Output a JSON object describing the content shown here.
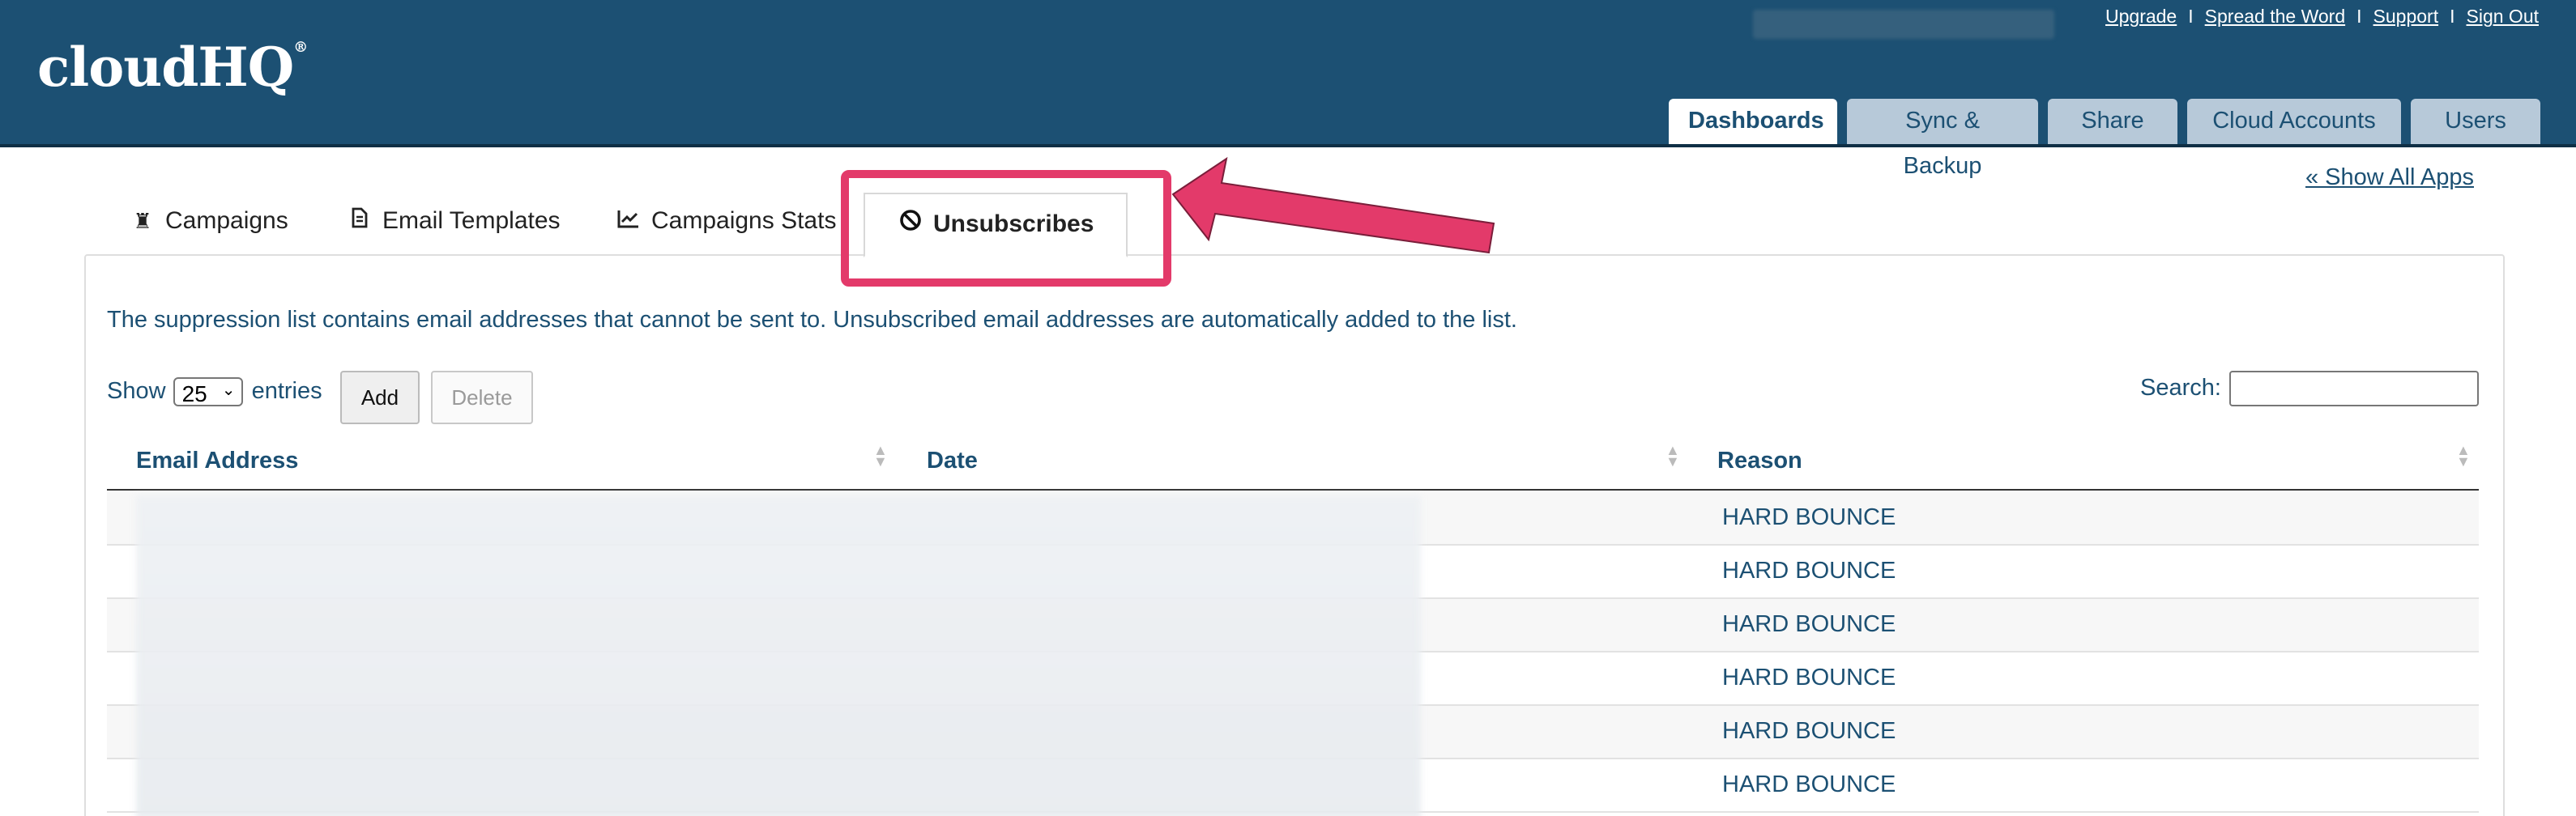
{
  "brand": {
    "logo_text": "cloudHQ",
    "registered_mark": "®"
  },
  "top_links": [
    "Upgrade",
    "Spread the Word",
    "Support",
    "Sign Out"
  ],
  "top_link_separator": "I",
  "main_tabs": [
    {
      "label": "Dashboards",
      "active": true
    },
    {
      "label": "Sync & Backup",
      "active": false
    },
    {
      "label": "Share",
      "active": false
    },
    {
      "label": "Cloud Accounts",
      "active": false
    },
    {
      "label": "Users",
      "active": false
    }
  ],
  "show_all_apps": "« Show All Apps",
  "sub_tabs": [
    {
      "label": "Campaigns",
      "icon": "chess-pawn-icon",
      "active": false
    },
    {
      "label": "Email Templates",
      "icon": "document-icon",
      "active": false
    },
    {
      "label": "Campaigns Stats",
      "icon": "line-chart-icon",
      "active": false
    },
    {
      "label": "Unsubscribes",
      "icon": "ban-icon",
      "active": true
    }
  ],
  "description": "The suppression list contains email addresses that cannot be sent to. Unsubscribed email addresses are automatically added to the list.",
  "show_label": "Show",
  "entries_value": "25",
  "entries_label": "entries",
  "add_button": "Add",
  "delete_button": "Delete",
  "search_label": "Search:",
  "search_value": "",
  "table": {
    "columns": [
      "Email Address",
      "Date",
      "Reason"
    ],
    "rows": [
      {
        "reason": "HARD BOUNCE"
      },
      {
        "reason": "HARD BOUNCE"
      },
      {
        "reason": "HARD BOUNCE"
      },
      {
        "reason": "HARD BOUNCE"
      },
      {
        "reason": "HARD BOUNCE"
      },
      {
        "reason": "HARD BOUNCE"
      }
    ]
  },
  "colors": {
    "header": "#1c5073",
    "highlight": "#e33a6a",
    "tab_inactive": "#b7c9d9"
  }
}
